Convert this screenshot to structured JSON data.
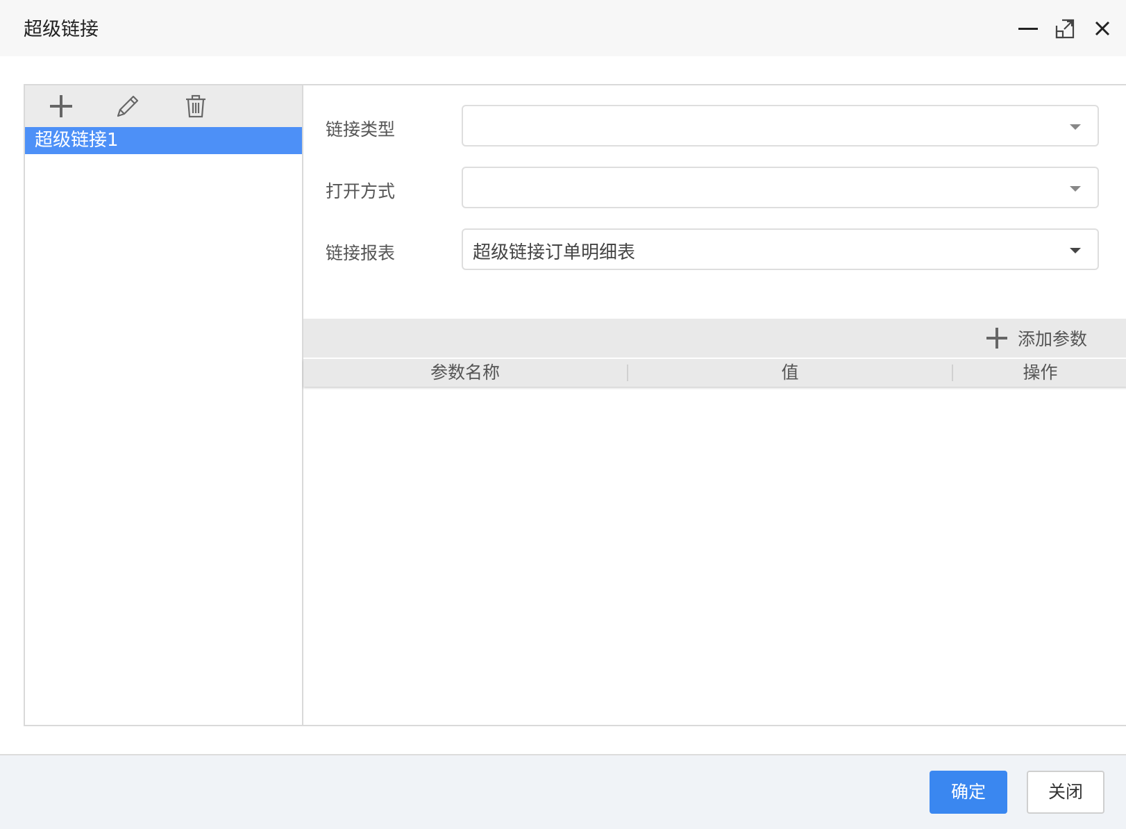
{
  "dialog": {
    "title": "超级链接"
  },
  "window_controls": {
    "minimize_icon": "minimize-icon",
    "maximize_icon": "maximize-icon",
    "close_icon": "close-icon"
  },
  "left_panel": {
    "toolbar": [
      "plus-icon",
      "pencil-icon",
      "trash-icon"
    ],
    "items": [
      {
        "label": "超级链接1",
        "selected": true
      }
    ]
  },
  "form": {
    "link_type": {
      "label": "链接类型",
      "value": ""
    },
    "open_mode": {
      "label": "打开方式",
      "value": ""
    },
    "link_report": {
      "label": "链接报表",
      "value": "超级链接订单明细表"
    }
  },
  "params": {
    "add_label": "添加参数",
    "columns": [
      "参数名称",
      "值",
      "操作"
    ],
    "rows": []
  },
  "footer": {
    "ok_label": "确定",
    "close_label": "关闭"
  },
  "colors": {
    "accent": "#4d90f7",
    "primary_button": "#3a87f0"
  }
}
